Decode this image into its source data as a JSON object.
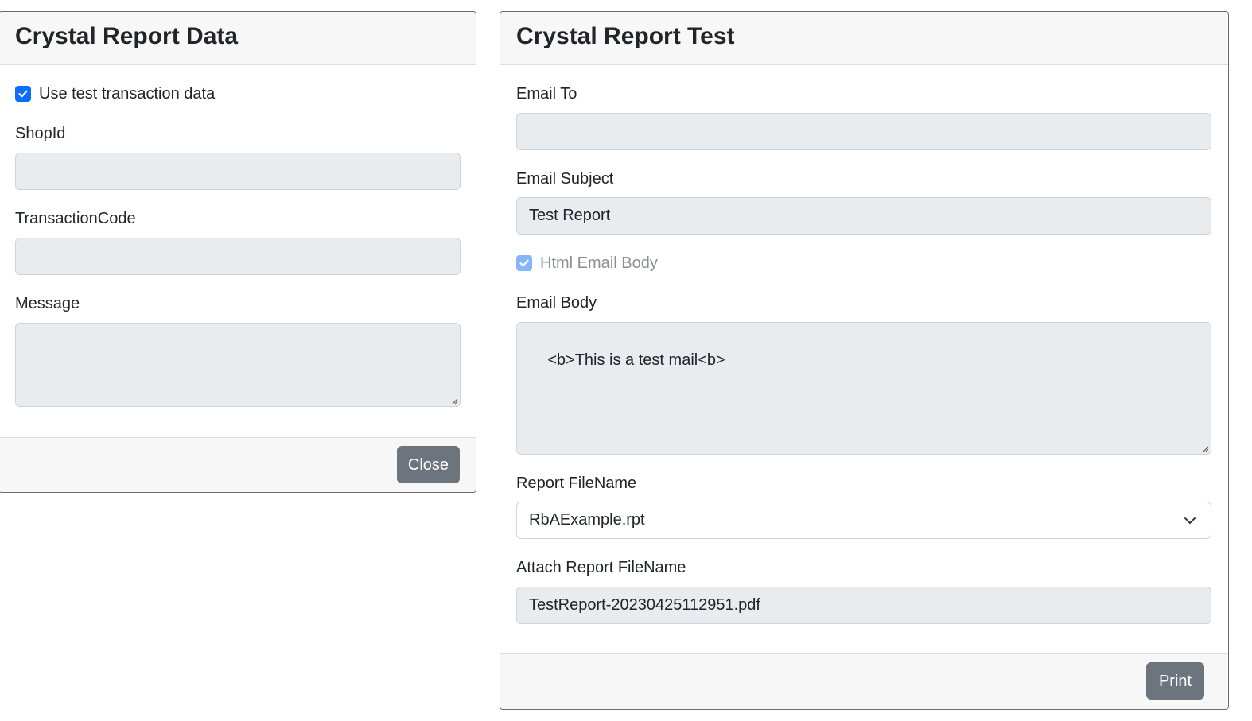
{
  "left_card": {
    "title": "Crystal Report Data",
    "use_test_checkbox": {
      "label": "Use test transaction data",
      "checked": true
    },
    "shop_id": {
      "label": "ShopId",
      "value": ""
    },
    "transaction_code": {
      "label": "TransactionCode",
      "value": ""
    },
    "message": {
      "label": "Message",
      "value": ""
    },
    "close_button": "Close"
  },
  "right_card": {
    "title": "Crystal Report Test",
    "email_to": {
      "label": "Email To",
      "value": ""
    },
    "email_subject": {
      "label": "Email Subject",
      "value": "Test Report"
    },
    "html_body_checkbox": {
      "label": "Html Email Body",
      "checked": true,
      "disabled": true
    },
    "email_body": {
      "label": "Email Body",
      "value": "<b>This is a test mail<b>"
    },
    "report_filename": {
      "label": "Report FileName",
      "selected": "RbAExample.rpt"
    },
    "attach_filename": {
      "label": "Attach Report FileName",
      "value": "TestReport-20230425112951.pdf"
    },
    "print_button": "Print"
  },
  "colors": {
    "checkbox_accent": "#0d6efd",
    "button_secondary": "#6c757d",
    "readonly_field": "#e9ecef"
  },
  "icons": [
    "check-icon",
    "chevron-down-icon",
    "resize-grip-icon"
  ]
}
